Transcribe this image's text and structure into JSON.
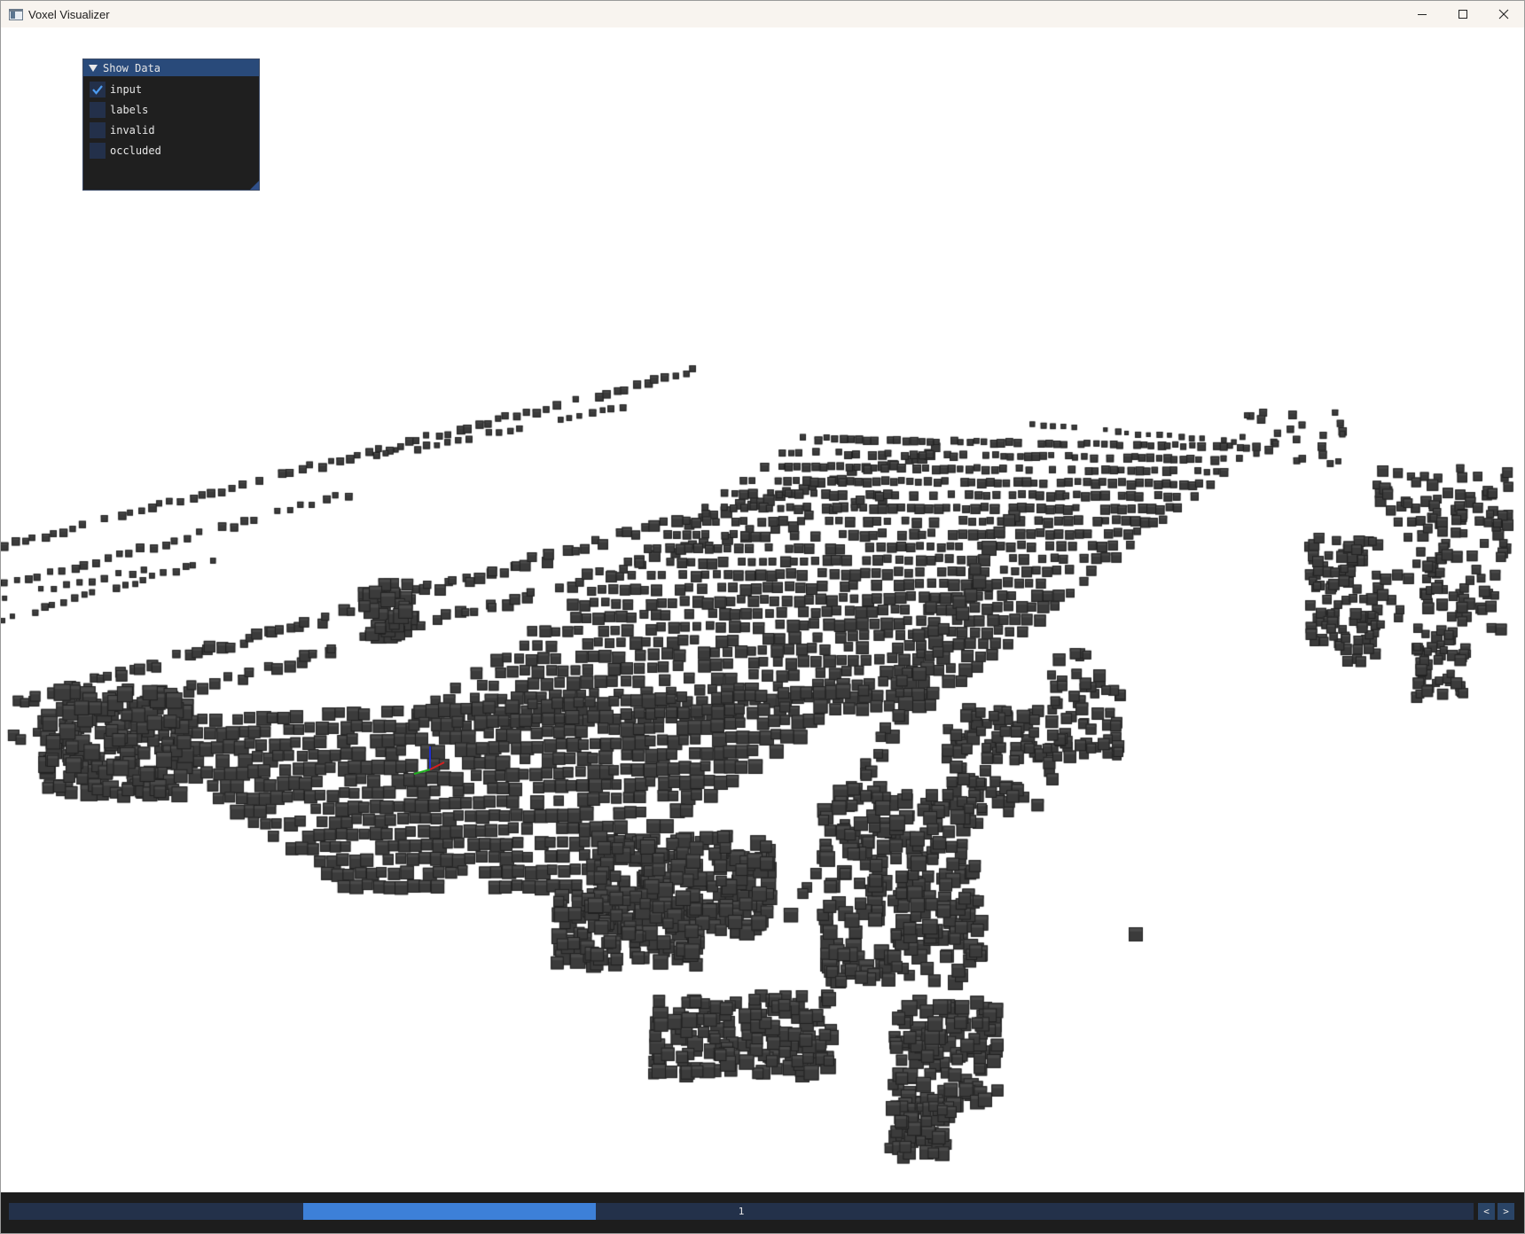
{
  "window": {
    "title": "Voxel Visualizer"
  },
  "panel": {
    "title": "Show Data",
    "checkboxes": [
      {
        "label": "input",
        "checked": true
      },
      {
        "label": "labels",
        "checked": false
      },
      {
        "label": "invalid",
        "checked": false
      },
      {
        "label": "occluded",
        "checked": false
      }
    ]
  },
  "frame_slider": {
    "value": "1",
    "prev_label": "<",
    "next_label": ">"
  },
  "colors": {
    "voxel": "#3a3a3a",
    "panel_header": "#294a7a",
    "slider_grab": "#3d80d8",
    "axis_x": "#d62020",
    "axis_y": "#20b020",
    "axis_z": "#2030d0"
  }
}
